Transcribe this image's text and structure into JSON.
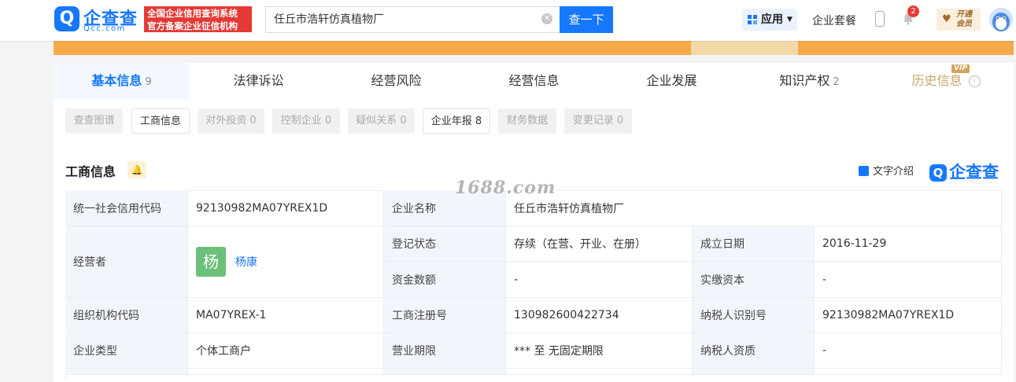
{
  "header": {
    "logo_cn": "企查查",
    "logo_en": "Qcc.com",
    "slogan_line1": "全国企业信用查询系统",
    "slogan_line2": "官方备案企业征信机构",
    "search_value": "任丘市浩轩仿真植物厂",
    "search_button": "查一下",
    "app_label": "应用",
    "package_label": "企业套餐",
    "notification_count": "2",
    "vip_open_line1": "开通",
    "vip_open_line2": "会员"
  },
  "tabs": [
    {
      "label": "基本信息",
      "count": "9"
    },
    {
      "label": "法律诉讼",
      "count": ""
    },
    {
      "label": "经营风险",
      "count": ""
    },
    {
      "label": "经营信息",
      "count": ""
    },
    {
      "label": "企业发展",
      "count": ""
    },
    {
      "label": "知识产权",
      "count": "2"
    },
    {
      "label": "历史信息",
      "count": "",
      "badge": "VIP"
    }
  ],
  "subtabs": [
    {
      "label": "查查图谱"
    },
    {
      "label": "工商信息"
    },
    {
      "label": "对外投资 0"
    },
    {
      "label": "控制企业 0"
    },
    {
      "label": "疑似关系 0"
    },
    {
      "label": "企业年报 8"
    },
    {
      "label": "财务数据"
    },
    {
      "label": "变更记录 0"
    }
  ],
  "section": {
    "title": "工商信息",
    "intro_label": "文字介绍",
    "brand": "企查查"
  },
  "watermark": "1688.com",
  "table": {
    "credit_code_label": "统一社会信用代码",
    "credit_code": "92130982MA07YREX1D",
    "company_name_label": "企业名称",
    "company_name": "任丘市浩轩仿真植物厂",
    "operator_label": "经营者",
    "operator_avatar": "杨",
    "operator_name": "杨康",
    "reg_status_label": "登记状态",
    "reg_status": "存续（在营、开业、在册）",
    "found_date_label": "成立日期",
    "found_date": "2016-11-29",
    "capital_label": "资金数额",
    "capital": "-",
    "paid_capital_label": "实缴资本",
    "paid_capital": "-",
    "org_code_label": "组织机构代码",
    "org_code": "MA07YREX-1",
    "reg_no_label": "工商注册号",
    "reg_no": "130982600422734",
    "taxpayer_id_label": "纳税人识别号",
    "taxpayer_id": "92130982MA07YREX1D",
    "company_type_label": "企业类型",
    "company_type": "个体工商户",
    "term_label": "营业期限",
    "term": "*** 至 无固定期限",
    "taxpayer_qual_label": "纳税人资质",
    "taxpayer_qual": "-"
  }
}
